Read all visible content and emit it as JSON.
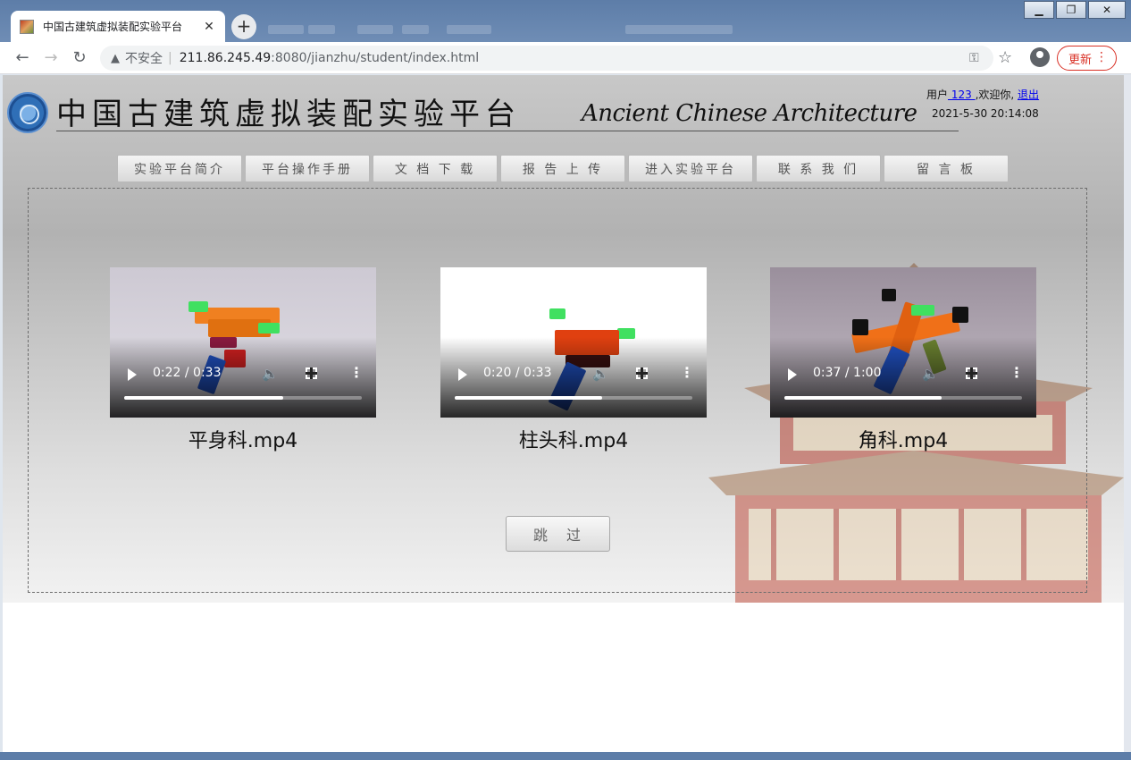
{
  "browser": {
    "tab_title": "中国古建筑虚拟装配实验平台",
    "tab_close": "✕",
    "new_tab": "+",
    "window_minimize": "▁",
    "window_maximize": "❐",
    "window_close": "✕",
    "back": "←",
    "forward": "→",
    "reload": "↻",
    "security_icon": "▲",
    "security_label": "不安全",
    "separator": "|",
    "url_host": "211.86.245.49",
    "url_path": ":8080/jianzhu/student/index.html",
    "key": "⚿",
    "star": "☆",
    "update_label": "更新",
    "menu_dots": "⋮"
  },
  "header": {
    "title": "中国古建筑虚拟装配实验平台",
    "subtitle": "Ancient Chinese Architecture",
    "user_prefix": "用户",
    "username": " 123 ",
    "welcome": ",欢迎你, ",
    "logout": "退出",
    "datetime": "2021-5-30 20:14:08"
  },
  "nav": [
    {
      "label": "实验平台简介"
    },
    {
      "label": "平台操作手册"
    },
    {
      "label": "文 档 下 载"
    },
    {
      "label": "报 告 上 传"
    },
    {
      "label": "进入实验平台"
    },
    {
      "label": "联 系 我 们"
    },
    {
      "label": "留 言 板"
    }
  ],
  "videos": [
    {
      "label": "平身科.mp4",
      "time": "0:22 / 0:33",
      "progress": 0.67
    },
    {
      "label": "柱头科.mp4",
      "time": "0:20 / 0:33",
      "progress": 0.62
    },
    {
      "label": "角科.mp4",
      "time": "0:37 / 1:00",
      "progress": 0.66
    }
  ],
  "skip_label": "跳 过",
  "icons": {
    "play": "play-icon",
    "volume": "volume-icon",
    "fullscreen": "fullscreen-icon",
    "more": "more-vert-icon",
    "volume_glyph": "🔈",
    "more_glyph": "⋮"
  },
  "colors": {
    "update_red": "#d93025",
    "link_blue": "#0000ee"
  }
}
